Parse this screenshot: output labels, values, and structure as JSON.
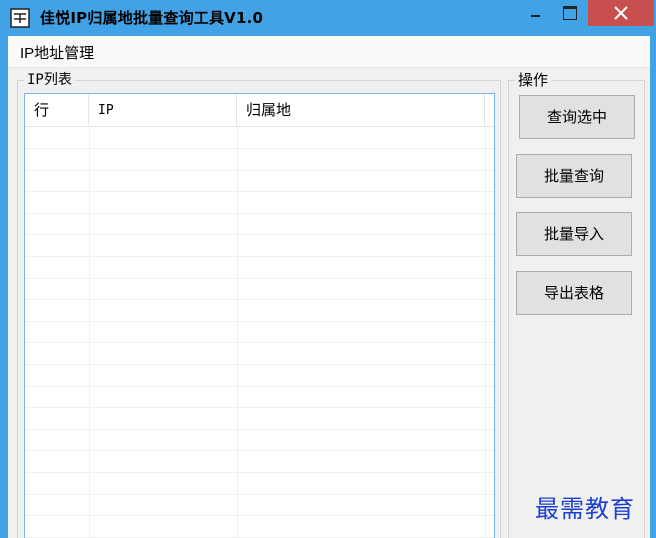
{
  "window": {
    "title": "佳悦IP归属地批量查询工具V1.0",
    "accent_color": "#41a3e6",
    "close_color": "#c7504f",
    "icons": {
      "app": "app-icon",
      "minimize": "minimize-icon",
      "maximize": "maximize-icon",
      "close": "close-icon"
    }
  },
  "menu": {
    "items": [
      {
        "label": "IP地址管理"
      }
    ]
  },
  "list_group": {
    "legend": "IP列表",
    "columns": [
      {
        "label": "行"
      },
      {
        "label": "IP"
      },
      {
        "label": "归属地"
      }
    ],
    "rows": []
  },
  "ops_group": {
    "legend": "操作",
    "buttons": [
      {
        "label": "查询选中"
      },
      {
        "label": "批量查询"
      },
      {
        "label": "批量导入"
      },
      {
        "label": "导出表格"
      }
    ]
  },
  "watermark": {
    "text": "最需教育",
    "color": "#1c3fd1"
  }
}
